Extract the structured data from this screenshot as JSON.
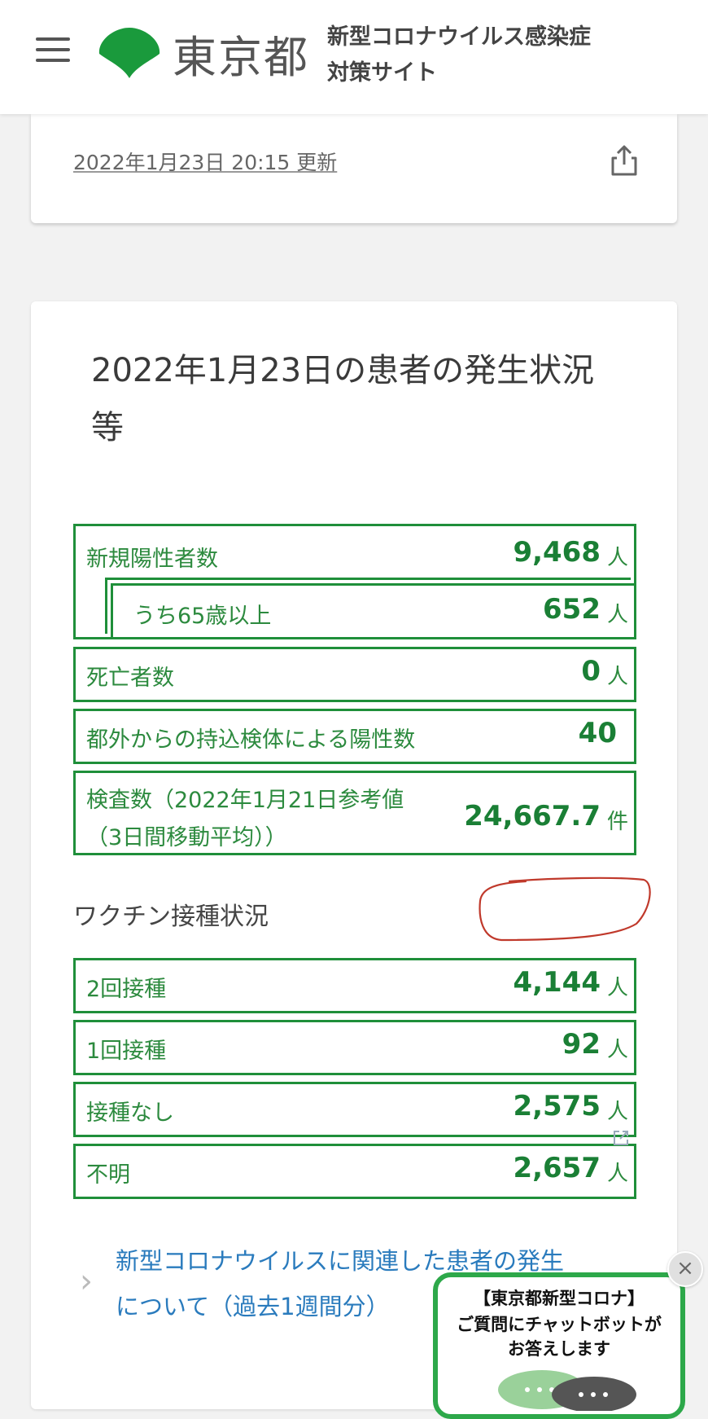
{
  "header": {
    "logo_text": "東京都",
    "site_title_line1": "新型コロナウイルス感染症",
    "site_title_line2": "対策サイト"
  },
  "update": {
    "text": "2022年1月23日 20:15 更新"
  },
  "main": {
    "title": "2022年1月23日の患者の発生状況等",
    "stats": {
      "new_positive": {
        "label": "新規陽性者数",
        "value": "9,468",
        "unit": "人"
      },
      "over65": {
        "label": "うち65歳以上",
        "value": "652",
        "unit": "人"
      },
      "deaths": {
        "label": "死亡者数",
        "value": "0",
        "unit": "人"
      },
      "outside": {
        "label": "都外からの持込検体による陽性数",
        "value": "40"
      },
      "tests": {
        "label_line1": "検査数（2022年1月21日参考値",
        "label_line2": "（3日間移動平均））",
        "value": "24,667.7",
        "unit": "件"
      }
    },
    "vaccine": {
      "heading": "ワクチン接種状況",
      "rows": [
        {
          "label": "2回接種",
          "value": "4,144",
          "unit": "人"
        },
        {
          "label": "1回接種",
          "value": "92",
          "unit": "人"
        },
        {
          "label": "接種なし",
          "value": "2,575",
          "unit": "人"
        },
        {
          "label": "不明",
          "value": "2,657",
          "unit": "人"
        }
      ]
    },
    "link": {
      "text_line1": "新型コロナウイルスに関連した患者の発生",
      "text_line2": "について（過去1週間分）"
    }
  },
  "chatbot": {
    "line1": "【東京都新型コロナ】",
    "line2": "ご質問にチャットボットが",
    "line3": "お答えします",
    "close": "×"
  },
  "colors": {
    "accent_green": "#1f8f3a",
    "link_blue": "#2a7bbd",
    "annotation_red": "#c0392b"
  }
}
